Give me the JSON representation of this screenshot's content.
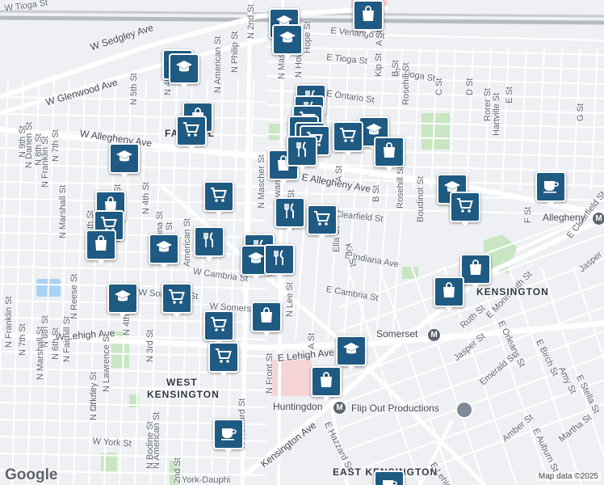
{
  "map": {
    "credit": "Map data ©2025",
    "logo": "Google",
    "colors": {
      "pin": "#1f5a82",
      "park": "#c8e6c2",
      "water": "#a9d3f5",
      "highlight": "#f6d4d6",
      "road": "#ffffff",
      "rail": "#b6bbc3"
    }
  },
  "areas": [
    {
      "id": "fairhill",
      "text": "FAIRHILL"
    },
    {
      "id": "kensington",
      "text": "KENSINGTON"
    },
    {
      "id": "west-kensington-1",
      "text": "WEST"
    },
    {
      "id": "west-kensington-2",
      "text": "KENSINGTON"
    },
    {
      "id": "east-kensington",
      "text": "EAST KENSINGTON"
    }
  ],
  "stations": [
    {
      "id": "allegheny",
      "text": "Allegheny"
    },
    {
      "id": "somerset",
      "text": "Somerset"
    },
    {
      "id": "huntingdon",
      "text": "Huntingdon"
    }
  ],
  "places": [
    {
      "id": "flip-out",
      "text": "Flip Out Productions"
    }
  ],
  "streets": [
    {
      "id": "w-tioga",
      "text": "W Tioga St"
    },
    {
      "id": "w-sedgley",
      "text": "W Sedgley Ave"
    },
    {
      "id": "w-glenwood",
      "text": "W Glenwood Ave"
    },
    {
      "id": "w-allegheny",
      "text": "W Allegheny Ave"
    },
    {
      "id": "e-allegheny",
      "text": "E Allegheny Ave"
    },
    {
      "id": "e-venango",
      "text": "E Venango St"
    },
    {
      "id": "e-tioga-1",
      "text": "E Tioga St"
    },
    {
      "id": "e-tioga-2",
      "text": "E Tioga St"
    },
    {
      "id": "e-ontario",
      "text": "E Ontario St"
    },
    {
      "id": "e-clearfield",
      "text": "E Clearfield St"
    },
    {
      "id": "e-clearfield-2",
      "text": "E Clearfield St"
    },
    {
      "id": "e-indiana",
      "text": "E Indiana Ave"
    },
    {
      "id": "e-cambria",
      "text": "E Cambria St"
    },
    {
      "id": "w-cambria",
      "text": "W Cambria St"
    },
    {
      "id": "w-somerset-1",
      "text": "W Somerset St"
    },
    {
      "id": "w-somerset-2",
      "text": "W Somers"
    },
    {
      "id": "w-lehigh",
      "text": "W Lehigh Ave"
    },
    {
      "id": "e-lehigh",
      "text": "E Lehigh Ave"
    },
    {
      "id": "w-york",
      "text": "W York St"
    },
    {
      "id": "york-dauphin",
      "text": "York-Dauphi"
    },
    {
      "id": "kensington-ave",
      "text": "Kensington Ave"
    },
    {
      "id": "e-hazzard",
      "text": "E Hazzard St"
    },
    {
      "id": "ruth",
      "text": "Ruth St"
    },
    {
      "id": "e-monmouth",
      "text": "E Monmouth St"
    },
    {
      "id": "jasper",
      "text": "Jasper St"
    },
    {
      "id": "emerald",
      "text": "Emerald St"
    },
    {
      "id": "amber",
      "text": "Amber St"
    },
    {
      "id": "martha",
      "text": "Martha St"
    },
    {
      "id": "e-orleans",
      "text": "E Orleans St"
    },
    {
      "id": "e-birch",
      "text": "E Birch St"
    },
    {
      "id": "e-auburn",
      "text": "E Auburn St"
    },
    {
      "id": "e-lehigh-diag",
      "text": "E Lehigh"
    },
    {
      "id": "e-stella",
      "text": "E Stella St"
    },
    {
      "id": "amy",
      "text": "Amy St"
    },
    {
      "id": "jasper-2",
      "text": "Jasper"
    },
    {
      "id": "boudinot",
      "text": "Boudinot St"
    },
    {
      "id": "rosehill-1",
      "text": "Rosehill St"
    },
    {
      "id": "rosehill-2",
      "text": "Rosehill St"
    },
    {
      "id": "kip-1",
      "text": "Kip St"
    },
    {
      "id": "kip-2",
      "text": "Kip St"
    },
    {
      "id": "kip-3",
      "text": "Kip St"
    },
    {
      "id": "b-st-1",
      "text": "B St"
    },
    {
      "id": "b-st-2",
      "text": "B St"
    },
    {
      "id": "a-st-1",
      "text": "A St"
    },
    {
      "id": "a-st-2",
      "text": "A St"
    },
    {
      "id": "a-st-3",
      "text": "A St"
    },
    {
      "id": "ella",
      "text": "Ella St"
    },
    {
      "id": "c-st",
      "text": "C St"
    },
    {
      "id": "d-st",
      "text": "D St"
    },
    {
      "id": "e-st",
      "text": "E St"
    },
    {
      "id": "f-st",
      "text": "F St"
    },
    {
      "id": "g-st",
      "text": "G St"
    },
    {
      "id": "rorer",
      "text": "Rorer St"
    },
    {
      "id": "hartville",
      "text": "Hartville St"
    },
    {
      "id": "n-mascher-1",
      "text": "N Mascher St"
    },
    {
      "id": "n-mascher-2",
      "text": "N Mascher St"
    },
    {
      "id": "n-howard-1",
      "text": "N Howard St"
    },
    {
      "id": "n-howard-2",
      "text": "N Howard St"
    },
    {
      "id": "n-howard-3",
      "text": "N Howard St"
    },
    {
      "id": "n-front-1",
      "text": "N Front St"
    },
    {
      "id": "n-front-2",
      "text": "N Front St"
    },
    {
      "id": "n-lee",
      "text": "N Lee St"
    },
    {
      "id": "hope",
      "text": "Hope St"
    },
    {
      "id": "n-2nd-1",
      "text": "N 2nd St"
    },
    {
      "id": "n-2nd-2",
      "text": "2nd St"
    },
    {
      "id": "n-philip",
      "text": "N Philip St"
    },
    {
      "id": "n-american-1",
      "text": "N American St"
    },
    {
      "id": "n-american-2",
      "text": "American St"
    },
    {
      "id": "n-american-3",
      "text": "N American St"
    },
    {
      "id": "n-4th-1",
      "text": "N 4th St"
    },
    {
      "id": "n-4th-2",
      "text": "N 4th St"
    },
    {
      "id": "n-4th-3",
      "text": "N 4th St"
    },
    {
      "id": "n-3rd-1",
      "text": "N 3rd St"
    },
    {
      "id": "n-3rd-2",
      "text": "N 3rd St"
    },
    {
      "id": "n-5th-1",
      "text": "N 5th St"
    },
    {
      "id": "n-5th-2",
      "text": "N 5th St"
    },
    {
      "id": "n-6th-1",
      "text": "N 6th St"
    },
    {
      "id": "n-6th-2",
      "text": "N 6th St"
    },
    {
      "id": "n-7th-1",
      "text": "N 7th St"
    },
    {
      "id": "n-7th-2",
      "text": "N 7th St"
    },
    {
      "id": "n-8th-1",
      "text": "N 8th St"
    },
    {
      "id": "n-8th-2",
      "text": "N 8th St"
    },
    {
      "id": "n-9th",
      "text": "N 9th St"
    },
    {
      "id": "n-franklin-1",
      "text": "N Franklin St"
    },
    {
      "id": "n-franklin-2",
      "text": "N Franklin St"
    },
    {
      "id": "n-darien",
      "text": "N Darien St"
    },
    {
      "id": "n-marshall-1",
      "text": "N Marshall St"
    },
    {
      "id": "n-marshall-2",
      "text": "N Marshall St"
    },
    {
      "id": "n-lawrence-1",
      "text": "N Lawrence St"
    },
    {
      "id": "n-lawrence-2",
      "text": "N Lawrence St"
    },
    {
      "id": "n-reese",
      "text": "N Reese St"
    },
    {
      "id": "n-fairhill",
      "text": "N Fairhill St"
    },
    {
      "id": "n-orkney",
      "text": "N Orkney St"
    },
    {
      "id": "n-orianna",
      "text": "N Orianna St"
    },
    {
      "id": "n-bodine",
      "text": "N Bodine St"
    }
  ],
  "pins": [
    {
      "id": "p1",
      "icon": "school-icon"
    },
    {
      "id": "p2",
      "icon": "school-icon"
    },
    {
      "id": "p3",
      "icon": "shopping-bag-icon"
    },
    {
      "id": "p4",
      "icon": "school-icon"
    },
    {
      "id": "p5",
      "icon": "school-icon"
    },
    {
      "id": "p6",
      "icon": "restaurant-icon"
    },
    {
      "id": "p7",
      "icon": "restaurant-icon"
    },
    {
      "id": "p8",
      "icon": "shopping-cart-icon"
    },
    {
      "id": "p9",
      "icon": "restaurant-icon"
    },
    {
      "id": "p10",
      "icon": "restaurant-icon"
    },
    {
      "id": "p11",
      "icon": "shopping-cart-icon"
    },
    {
      "id": "p12",
      "icon": "school-icon"
    },
    {
      "id": "p13",
      "icon": "shopping-bag-icon"
    },
    {
      "id": "p14",
      "icon": "shopping-bag-icon"
    },
    {
      "id": "p15",
      "icon": "shopping-cart-icon"
    },
    {
      "id": "p16",
      "icon": "restaurant-icon"
    },
    {
      "id": "p17",
      "icon": "shopping-cart-icon"
    },
    {
      "id": "p18",
      "icon": "shopping-cart-icon"
    },
    {
      "id": "p19",
      "icon": "school-icon"
    },
    {
      "id": "p20",
      "icon": "shopping-bag-icon"
    },
    {
      "id": "p21",
      "icon": "shopping-cart-icon"
    },
    {
      "id": "p22",
      "icon": "shopping-bag-icon"
    },
    {
      "id": "p23",
      "icon": "school-icon"
    },
    {
      "id": "p24",
      "icon": "restaurant-icon"
    },
    {
      "id": "p25",
      "icon": "restaurant-icon"
    },
    {
      "id": "p26",
      "icon": "school-icon"
    },
    {
      "id": "p27",
      "icon": "restaurant-icon"
    },
    {
      "id": "p28",
      "icon": "school-icon"
    },
    {
      "id": "p29",
      "icon": "shopping-cart-icon"
    },
    {
      "id": "p30",
      "icon": "shopping-bag-icon"
    },
    {
      "id": "p31",
      "icon": "shopping-cart-icon"
    },
    {
      "id": "p32",
      "icon": "shopping-cart-icon"
    },
    {
      "id": "p33",
      "icon": "school-icon"
    },
    {
      "id": "p34",
      "icon": "shopping-bag-icon"
    },
    {
      "id": "p35",
      "icon": "coffee-icon"
    },
    {
      "id": "p36",
      "icon": "school-icon"
    },
    {
      "id": "p37",
      "icon": "shopping-cart-icon"
    },
    {
      "id": "p38",
      "icon": "coffee-icon"
    },
    {
      "id": "p39",
      "icon": "shopping-bag-icon"
    },
    {
      "id": "p40",
      "icon": "shopping-bag-icon"
    },
    {
      "id": "p41",
      "icon": "coffee-icon"
    }
  ]
}
